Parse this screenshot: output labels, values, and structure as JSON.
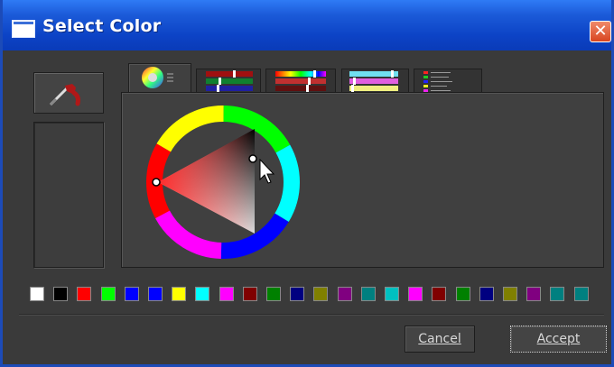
{
  "window": {
    "title": "Select Color",
    "close_glyph": "✕"
  },
  "tabs": [
    {
      "name": "wheel"
    },
    {
      "name": "rgb-sliders"
    },
    {
      "name": "hsv-sliders"
    },
    {
      "name": "cmy-sliders"
    },
    {
      "name": "palette-list"
    }
  ],
  "swatches": [
    "#ffffff",
    "#000000",
    "#ff0000",
    "#00ff00",
    "#0000ff",
    "#0000ff",
    "#ffff00",
    "#00ffff",
    "#ff00ff",
    "#800000",
    "#008000",
    "#000080",
    "#808000",
    "#800080",
    "#008080",
    "#00c0c0",
    "#ff00ff",
    "#800000",
    "#008000",
    "#000080",
    "#808000",
    "#800080",
    "#008080",
    "#008080"
  ],
  "buttons": {
    "cancel": "Cancel",
    "accept": "Accept"
  }
}
